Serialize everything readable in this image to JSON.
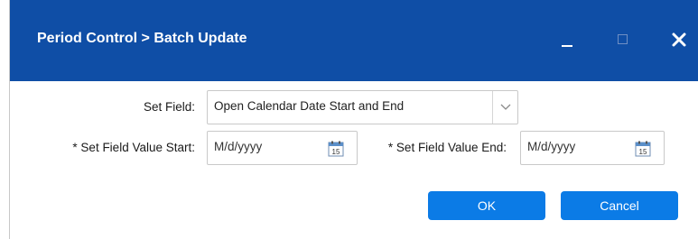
{
  "dialog": {
    "title": "Period Control > Batch Update"
  },
  "icons": {
    "minimize": "minimize-icon",
    "maximize": "maximize-icon",
    "close": "close-icon",
    "dropdown": "chevron-down-icon",
    "calendar": "calendar-icon"
  },
  "form": {
    "set_field_label": "Set Field:",
    "set_field_value": "Open Calendar Date Start and End",
    "start_label": "* Set Field Value Start:",
    "start_placeholder": "M/d/yyyy",
    "end_label": "* Set Field Value End:",
    "end_placeholder": "M/d/yyyy",
    "calendar_day": "15"
  },
  "buttons": {
    "ok": "OK",
    "cancel": "Cancel"
  },
  "colors": {
    "titlebar": "#0f4ea6",
    "button": "#0b7be6"
  }
}
